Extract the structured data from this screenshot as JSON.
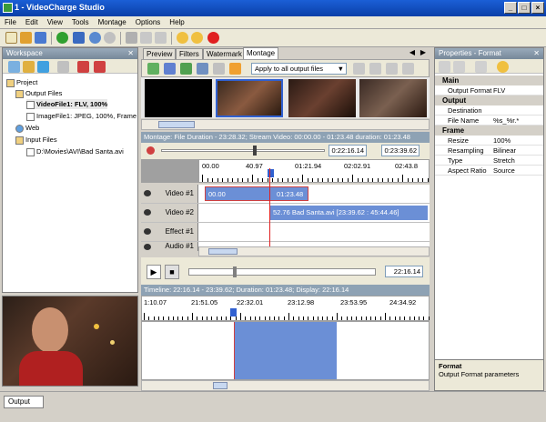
{
  "window": {
    "title": "1 - VideoCharge Studio"
  },
  "menu": [
    "File",
    "Edit",
    "View",
    "Tools",
    "Montage",
    "Options",
    "Help"
  ],
  "workspace": {
    "title": "Workspace",
    "tree": [
      {
        "label": "Project",
        "level": 0
      },
      {
        "label": "Output Files",
        "level": 1
      },
      {
        "label": "VideoFile1: FLV, 100%",
        "level": 2
      },
      {
        "label": "ImageFile1: JPEG, 100%, Frame",
        "level": 2
      },
      {
        "label": "Web",
        "level": 1
      },
      {
        "label": "Input Files",
        "level": 1
      },
      {
        "label": "D:\\Movies\\AVI\\Bad Santa.avi",
        "level": 2
      }
    ]
  },
  "tabs": [
    "Preview",
    "Filters",
    "Watermark",
    "Montage"
  ],
  "montage": {
    "apply_select": "Apply to all output files",
    "info_top": "Montage: File Duration - 23:28.32; Stream Video: 00:00.00 - 01:23.48 duration: 01:23.48",
    "time_start": "0:22:16.14",
    "time_end": "0:23:39.62",
    "ruler_top_labels": [
      "00.00",
      "40.97",
      "01:21.94",
      "02:02.91",
      "02:43.8"
    ],
    "tracks": [
      {
        "label": "Video #1",
        "clip_text_a": "00.00",
        "clip_text_b": "01:23.48"
      },
      {
        "label": "Video #2",
        "clip_text": "52.76  Bad Santa.avi [23:39.62 : 45:44.46]"
      },
      {
        "label": "Effect #1"
      },
      {
        "label": "Audio #1"
      }
    ],
    "player_time": "22:16.14",
    "info_bottom": "Timeline: 22:16.14 - 23:39.62; Duration: 01:23.48; Display: 22:16.14",
    "ruler_bottom_labels": [
      "1:10.07",
      "21:51.05",
      "22:32.01",
      "23:12.98",
      "23:53.95",
      "24:34.92"
    ]
  },
  "properties": {
    "title": "Properties - Format",
    "categories": [
      {
        "name": "Main",
        "rows": [
          {
            "k": "Output Format",
            "v": "FLV"
          }
        ]
      },
      {
        "name": "Output",
        "rows": [
          {
            "k": "Destination",
            "v": ""
          },
          {
            "k": "File Name",
            "v": "%s_%r.*"
          }
        ]
      },
      {
        "name": "Frame",
        "rows": [
          {
            "k": "Resize",
            "v": "100%"
          },
          {
            "k": "Resampling",
            "v": "Bilinear"
          },
          {
            "k": "Type",
            "v": "Stretch"
          },
          {
            "k": "Aspect Ratio",
            "v": "Source"
          }
        ]
      }
    ],
    "desc_title": "Format",
    "desc_text": "Output Format parameters"
  },
  "status": {
    "output_tab": "Output"
  }
}
